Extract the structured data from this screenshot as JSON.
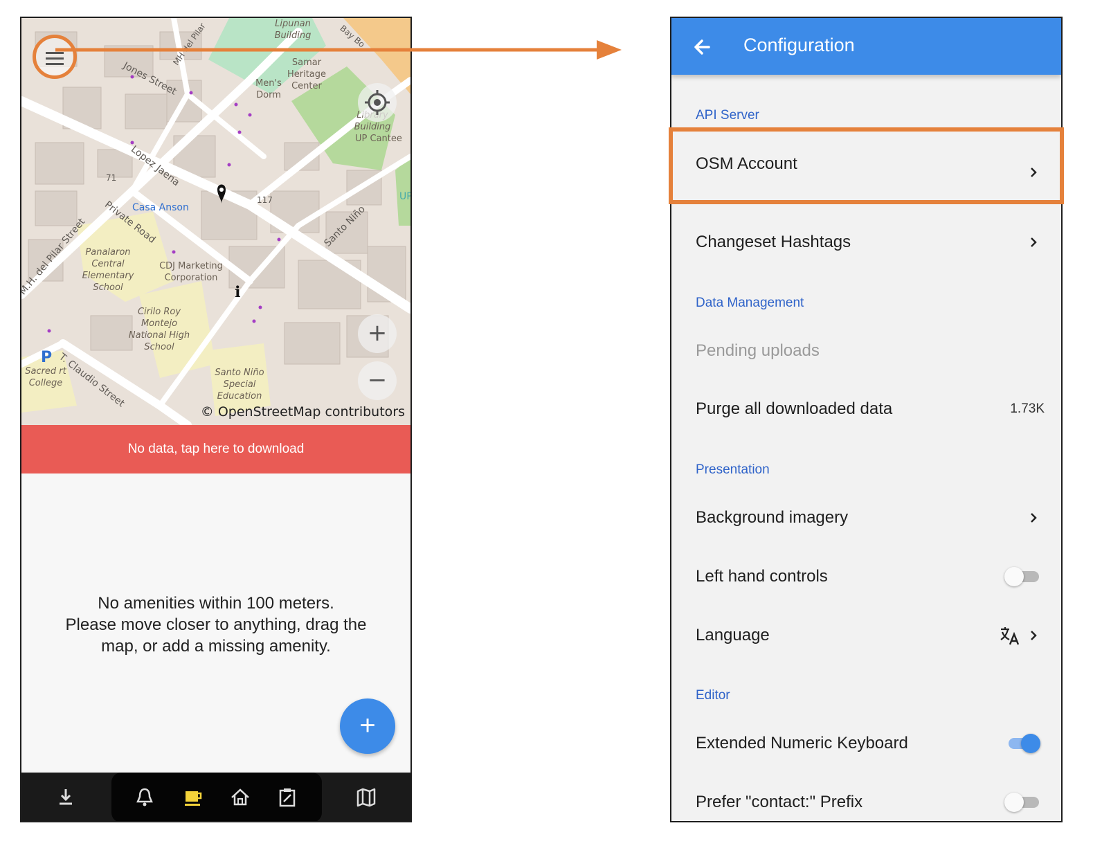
{
  "colors": {
    "accent_orange": "#e5813b",
    "app_bar_blue": "#3d8be8",
    "banner_red": "#e95b55",
    "section_header_blue": "#2f63c9"
  },
  "map": {
    "attribution": "© OpenStreetMap contributors",
    "street_labels": [
      "Jones Street",
      "Lopez Jaena",
      "Private Road",
      "M.H. del Pilar Street",
      "Santo Niño",
      "T. Claudio Street",
      "MH del Pilar",
      "Bay Bo"
    ],
    "place_labels": [
      "Lipunan Building",
      "Samar Heritage Center",
      "Men's Dorm",
      "Library Building",
      "UP Cantee",
      "Casa Anson",
      "CDJ Marketing Corporation",
      "Panalaron Central Elementary School",
      "Cirilo Roy Montejo National High School",
      "Santo Niño Special Education",
      "Sacred rt College",
      "UP",
      "71",
      "117"
    ],
    "icons": [
      "menu-icon",
      "locate-icon",
      "zoom-in-icon",
      "zoom-out-icon",
      "map-pin-icon",
      "info-icon",
      "parking-icon"
    ]
  },
  "left": {
    "banner": "No data, tap here to download",
    "empty_message_line1": "No amenities within 100 meters.",
    "empty_message_line2": "Please move closer to anything, drag the",
    "empty_message_line3": "map, or add a missing amenity.",
    "fab_label": "+",
    "bottom_nav_icons": [
      "download-icon",
      "bell-icon",
      "coffee-icon",
      "home-icon",
      "clipboard-icon",
      "map-icon"
    ]
  },
  "right": {
    "title": "Configuration",
    "sections": {
      "api_server": "API Server",
      "data_management": "Data Management",
      "presentation": "Presentation",
      "editor": "Editor"
    },
    "rows": {
      "osm_account": "OSM Account",
      "changeset_hashtags": "Changeset Hashtags",
      "pending_uploads": "Pending uploads",
      "purge_data": "Purge all downloaded data",
      "purge_value": "1.73K",
      "background_imagery": "Background imagery",
      "left_hand_controls": "Left hand controls",
      "left_hand_controls_on": false,
      "language": "Language",
      "extended_keyboard": "Extended Numeric Keyboard",
      "extended_keyboard_on": true,
      "prefer_contact": "Prefer \"contact:\" Prefix",
      "prefer_contact_on": false
    }
  }
}
